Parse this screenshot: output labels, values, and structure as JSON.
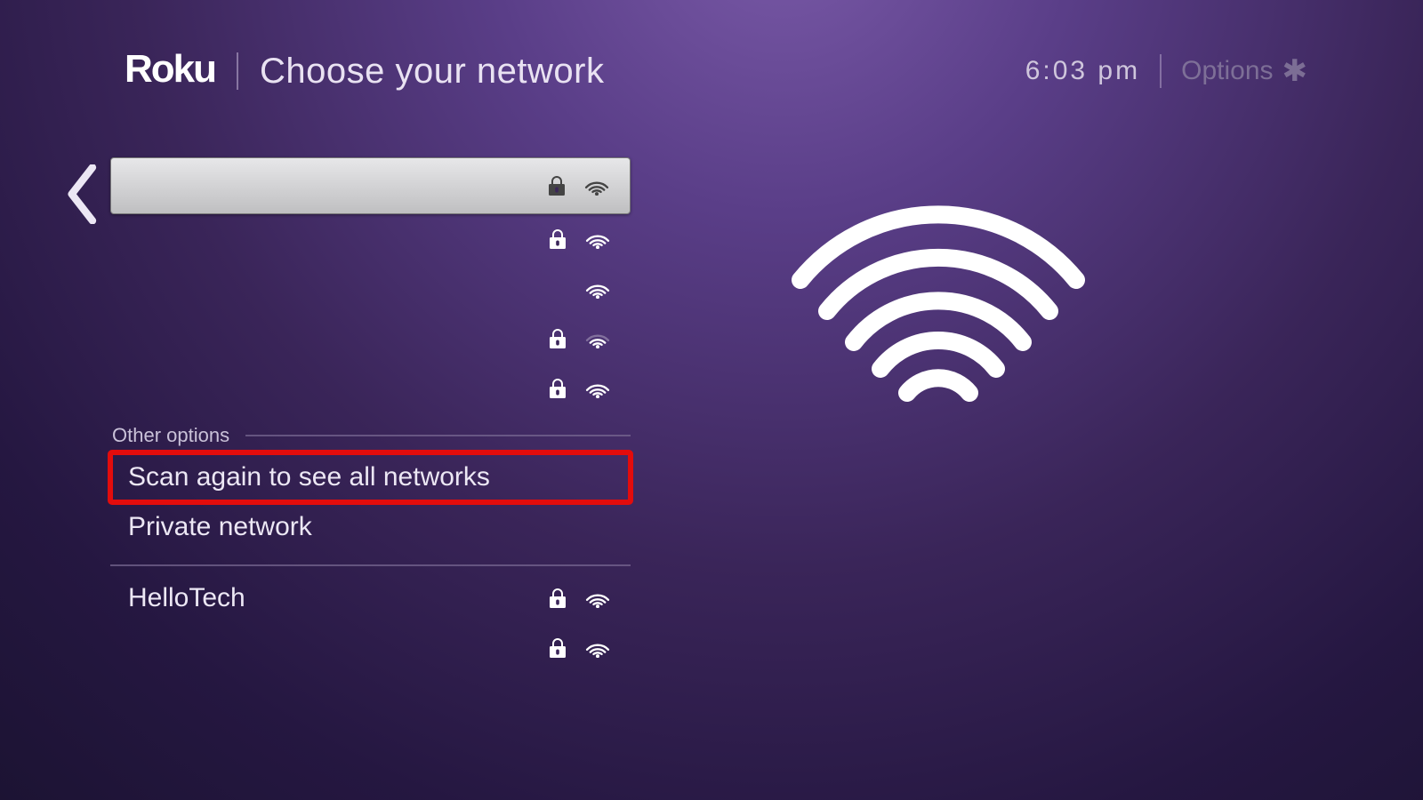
{
  "header": {
    "logo": "Roku",
    "title": "Choose your network",
    "clock": "6:03 pm",
    "options_label": "Options"
  },
  "networks": [
    {
      "name": "",
      "blurred": true,
      "locked": true,
      "signal": 4,
      "selected": true,
      "blur_width": 130
    },
    {
      "name": "",
      "blurred": true,
      "locked": true,
      "signal": 3,
      "selected": false,
      "blur_width": 340
    },
    {
      "name": "",
      "blurred": true,
      "locked": false,
      "signal": 3,
      "selected": false,
      "blur_width": 210
    },
    {
      "name": "",
      "blurred": true,
      "locked": true,
      "signal": 2,
      "selected": false,
      "blur_width": 140
    },
    {
      "name": "",
      "blurred": true,
      "locked": true,
      "signal": 3,
      "selected": false,
      "blur_width": 180
    }
  ],
  "other_section_label": "Other options",
  "other_options": [
    {
      "label": "Scan again to see all networks",
      "highlighted": true
    },
    {
      "label": "Private network",
      "highlighted": false
    }
  ],
  "more_networks": [
    {
      "name": "HelloTech",
      "blurred": false,
      "locked": true,
      "signal": 3,
      "blur_width": 0
    },
    {
      "name": "",
      "blurred": true,
      "locked": true,
      "signal": 4,
      "blur_width": 110
    }
  ]
}
